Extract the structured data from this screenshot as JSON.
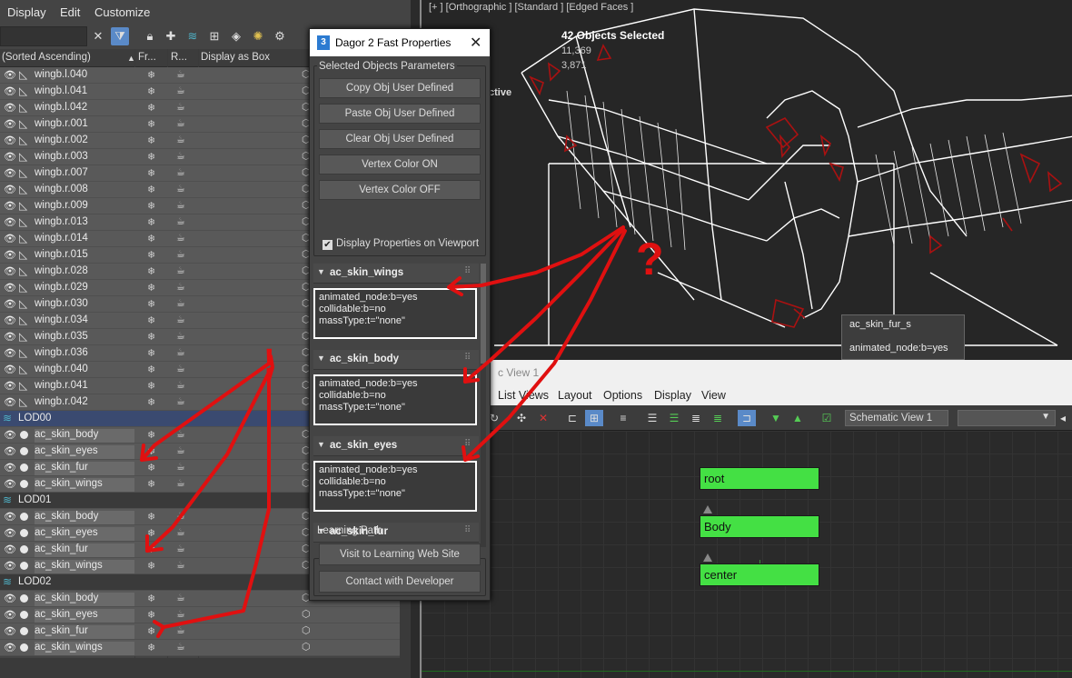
{
  "menu": {
    "display": "Display",
    "edit": "Edit",
    "customize": "Customize"
  },
  "toolbar": {
    "clear": "✕",
    "filter": "⧩",
    "icons": [
      "lock-icon",
      "add-icon",
      "layers-icon",
      "hierarchy-icon",
      "stack-icon",
      "light-icon",
      "settings-icon"
    ]
  },
  "columns": {
    "name": "(Sorted Ascending)",
    "frozen": "Fr...",
    "renderable": "R...",
    "display_as_box": "Display as Box"
  },
  "rows": [
    {
      "type": "bone",
      "name": "wingb.l.040"
    },
    {
      "type": "bone",
      "name": "wingb.l.041"
    },
    {
      "type": "bone",
      "name": "wingb.l.042"
    },
    {
      "type": "bone",
      "name": "wingb.r.001"
    },
    {
      "type": "bone",
      "name": "wingb.r.002"
    },
    {
      "type": "bone",
      "name": "wingb.r.003"
    },
    {
      "type": "bone",
      "name": "wingb.r.007"
    },
    {
      "type": "bone",
      "name": "wingb.r.008"
    },
    {
      "type": "bone",
      "name": "wingb.r.009"
    },
    {
      "type": "bone",
      "name": "wingb.r.013"
    },
    {
      "type": "bone",
      "name": "wingb.r.014"
    },
    {
      "type": "bone",
      "name": "wingb.r.015"
    },
    {
      "type": "bone",
      "name": "wingb.r.028"
    },
    {
      "type": "bone",
      "name": "wingb.r.029"
    },
    {
      "type": "bone",
      "name": "wingb.r.030"
    },
    {
      "type": "bone",
      "name": "wingb.r.034"
    },
    {
      "type": "bone",
      "name": "wingb.r.035"
    },
    {
      "type": "bone",
      "name": "wingb.r.036"
    },
    {
      "type": "bone",
      "name": "wingb.r.040"
    },
    {
      "type": "bone",
      "name": "wingb.r.041"
    },
    {
      "type": "bone",
      "name": "wingb.r.042"
    },
    {
      "type": "layer",
      "name": "LOD00",
      "selected": true
    },
    {
      "type": "obj",
      "name": "ac_skin_body"
    },
    {
      "type": "obj",
      "name": "ac_skin_eyes"
    },
    {
      "type": "obj",
      "name": "ac_skin_fur"
    },
    {
      "type": "obj",
      "name": "ac_skin_wings"
    },
    {
      "type": "layer",
      "name": "LOD01",
      "selected": false
    },
    {
      "type": "obj",
      "name": "ac_skin_body"
    },
    {
      "type": "obj",
      "name": "ac_skin_eyes"
    },
    {
      "type": "obj",
      "name": "ac_skin_fur"
    },
    {
      "type": "obj",
      "name": "ac_skin_wings"
    },
    {
      "type": "layer",
      "name": "LOD02",
      "selected": false
    },
    {
      "type": "obj",
      "name": "ac_skin_body"
    },
    {
      "type": "obj",
      "name": "ac_skin_eyes"
    },
    {
      "type": "obj",
      "name": "ac_skin_fur"
    },
    {
      "type": "obj",
      "name": "ac_skin_wings"
    }
  ],
  "viewport": {
    "label": "[+ ] [Orthographic ] [Standard ] [Edged Faces ]",
    "selected": "42 Objects Selected",
    "stat2": "11,369",
    "stat3": "3,871",
    "active": "ctive",
    "tooltip_line1": "ac_skin_fur_s",
    "tooltip_line2": "animated_node:b=yes"
  },
  "dialog": {
    "logo": "3",
    "title": "Dagor 2 Fast Properties",
    "close": "✕",
    "group_title": "Selected Objects Parameters",
    "buttons": [
      "Copy Obj User Defined",
      "Paste Obj User Defined",
      "Clear Obj User Defined",
      "Vertex Color ON",
      "Vertex Color OFF"
    ],
    "checkbox_label": "Display Properties on Viewport",
    "checkbox_mark": "✔",
    "rollouts": [
      {
        "title": "ac_skin_wings",
        "lines": [
          "animated_node:b=yes",
          "collidable:b=no",
          "massType:t=\"none\""
        ]
      },
      {
        "title": "ac_skin_body",
        "lines": [
          "animated_node:b=yes",
          "collidable:b=no",
          "massType:t=\"none\""
        ]
      },
      {
        "title": "ac_skin_eyes",
        "lines": [
          "animated_node:b=yes",
          "collidable:b=no",
          "massType:t=\"none\""
        ]
      },
      {
        "title": "ac_skin_fur",
        "lines": []
      }
    ],
    "learning_title": "Learning Path",
    "learning_buttons": [
      "Visit to Learning Web Site",
      "Contact with Developer"
    ]
  },
  "schematic": {
    "title": "c View 1",
    "menu": [
      "List Views",
      "Layout",
      "Options",
      "Display",
      "View"
    ],
    "combo": "Schematic View 1",
    "nodes": [
      "root",
      "Body",
      "center"
    ]
  },
  "annotations": {
    "question": "?",
    "exclamation": "!",
    "color": "#e01010"
  }
}
